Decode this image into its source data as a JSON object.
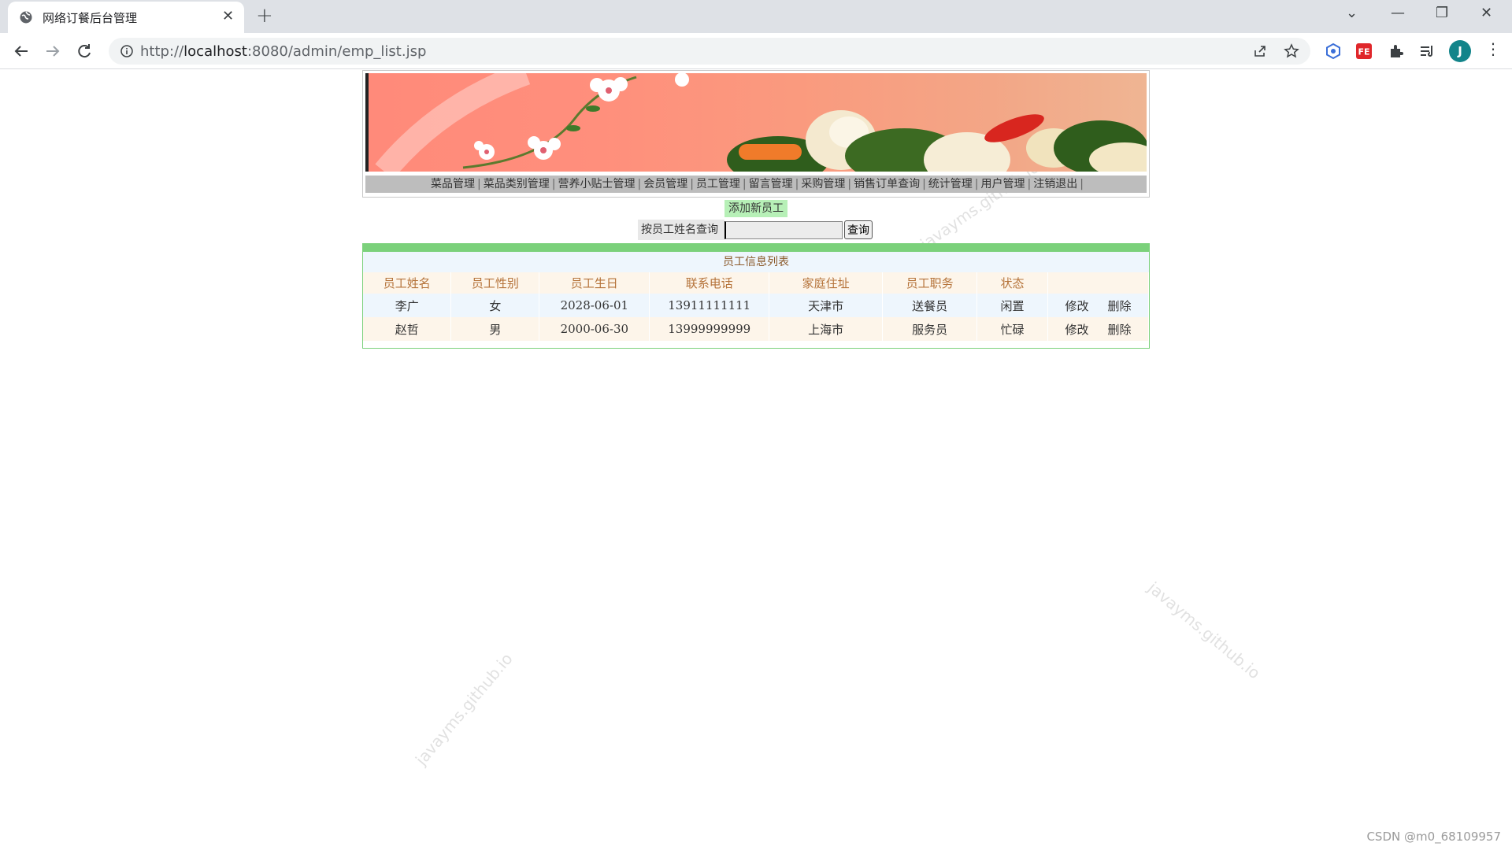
{
  "browser": {
    "tab_title": "网络订餐后台管理",
    "tab_close": "✕",
    "new_tab": "+",
    "url_scheme": "http://",
    "url_host": "localhost",
    "url_rest": ":8080/admin/emp_list.jsp",
    "avatar_letter": "J",
    "kebab": "⋮",
    "win_dropdown": "⌄",
    "win_minimize": "—",
    "win_restore": "❐",
    "win_close": "✕"
  },
  "page": {
    "watermark_text": "javayms.github.io",
    "menu": [
      "菜品管理",
      "菜品类别管理",
      "营养小贴士管理",
      "会员管理",
      "员工管理",
      "留言管理",
      "采购管理",
      "销售订单查询",
      "统计管理",
      "用户管理",
      "注销退出"
    ],
    "menu_separator": "|",
    "add_button": "添加新员工",
    "search_label": "按员工姓名查询",
    "search_value": "",
    "search_button": "查询",
    "table_title": "员工信息列表",
    "headers": [
      "员工姓名",
      "员工性别",
      "员工生日",
      "联系电话",
      "家庭住址",
      "员工职务",
      "状态"
    ],
    "rows": [
      {
        "name": "李广",
        "gender": "女",
        "birthday": "2028-06-01",
        "phone": "13911111111",
        "address": "天津市",
        "job": "送餐员",
        "status": "闲置",
        "edit": "修改",
        "delete": "删除"
      },
      {
        "name": "赵哲",
        "gender": "男",
        "birthday": "2000-06-30",
        "phone": "13999999999",
        "address": "上海市",
        "job": "服务员",
        "status": "忙碌",
        "edit": "修改",
        "delete": "删除"
      }
    ],
    "credit": "CSDN @m0_68109957"
  },
  "colors": {
    "banner_salmon": "#ff8a7a",
    "menu_gray": "#bdbdbd",
    "table_green": "#7bd17b",
    "add_green": "#b7f0b7",
    "header_text": "#b5733a"
  }
}
